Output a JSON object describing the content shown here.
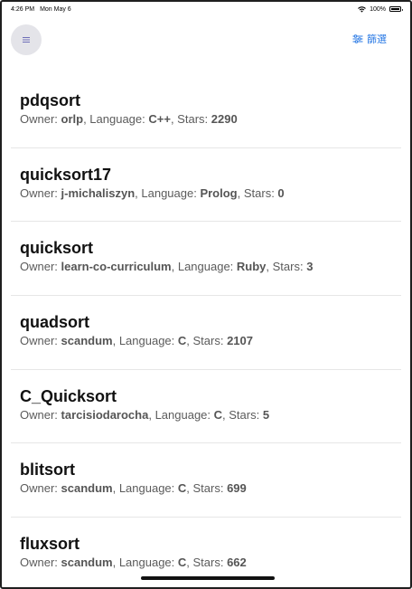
{
  "status_bar": {
    "time": "4:26 PM",
    "date": "Mon May 6",
    "battery": "100%"
  },
  "nav": {
    "filter_label": "篩選",
    "menu_icon": "menu-icon",
    "filter_icon": "sliders-icon"
  },
  "labels": {
    "owner": "Owner: ",
    "language": ", Language: ",
    "stars": ", Stars: "
  },
  "repos": [
    {
      "name": "pdqsort",
      "owner": "orlp",
      "language": "C++",
      "stars": "2290"
    },
    {
      "name": "quicksort17",
      "owner": "j-michaliszyn",
      "language": "Prolog",
      "stars": "0"
    },
    {
      "name": "quicksort",
      "owner": "learn-co-curriculum",
      "language": "Ruby",
      "stars": "3"
    },
    {
      "name": "quadsort",
      "owner": "scandum",
      "language": "C",
      "stars": "2107"
    },
    {
      "name": "C_Quicksort",
      "owner": "tarcisiodarocha",
      "language": "C",
      "stars": "5"
    },
    {
      "name": "blitsort",
      "owner": "scandum",
      "language": "C",
      "stars": "699"
    },
    {
      "name": "fluxsort",
      "owner": "scandum",
      "language": "C",
      "stars": "662"
    }
  ],
  "colors": {
    "accent": "#2c7be5",
    "menu_button_bg": "#e4e4e9",
    "divider": "#e6e6e6"
  }
}
